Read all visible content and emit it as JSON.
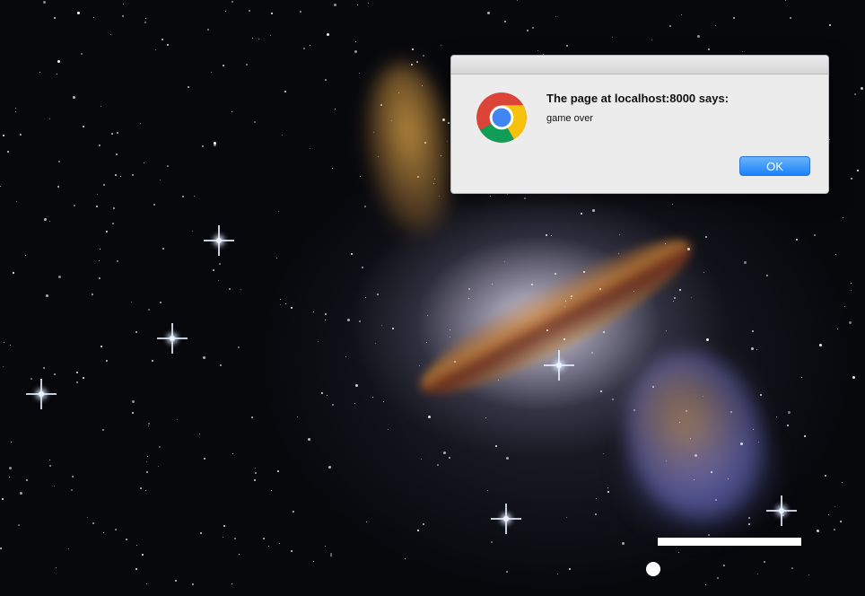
{
  "dialog": {
    "title": "The page at localhost:8000 says:",
    "message": "game over",
    "ok_label": "OK",
    "icon": "chrome-icon",
    "button_color": "#1a82fb"
  },
  "game": {
    "background": "galaxy-starfield-image",
    "paddle_color": "#ffffff",
    "ball_color": "#ffffff"
  }
}
